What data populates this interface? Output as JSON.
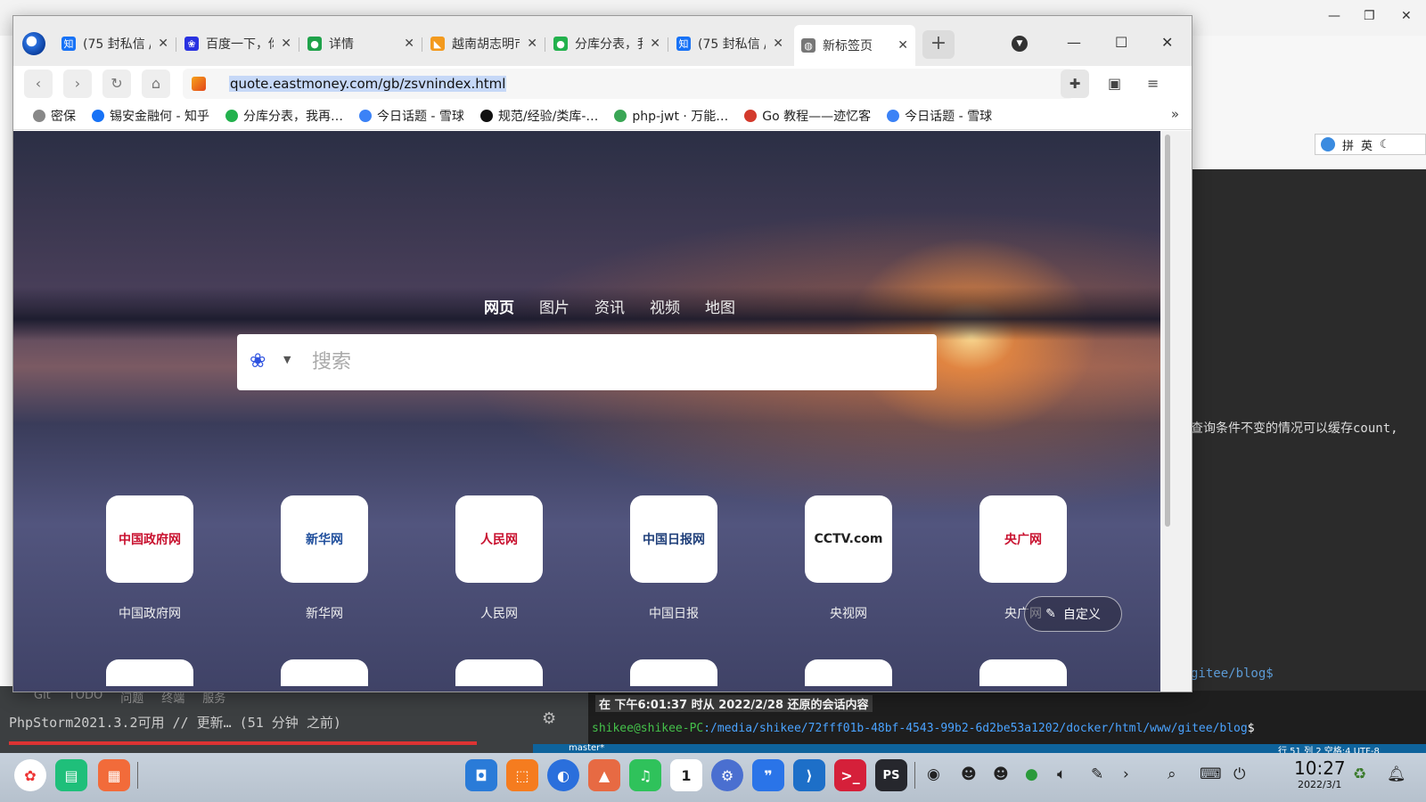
{
  "window": {
    "tabs": [
      {
        "title": "(75 封私信 /",
        "favicon": "zhihu-icon",
        "color": "#1772f6",
        "glyph": "知"
      },
      {
        "title": "百度一下，你",
        "favicon": "baidu-icon",
        "color": "#2932e1",
        "glyph": "❀"
      },
      {
        "title": "详情",
        "favicon": "green-circle-icon",
        "color": "#1fa24a",
        "glyph": "●"
      },
      {
        "title": "越南胡志明市",
        "favicon": "eastmoney-icon",
        "color": "#f39a1e",
        "glyph": "◣"
      },
      {
        "title": "分库分表，我",
        "favicon": "wechat-icon",
        "color": "#23b14d",
        "glyph": "●"
      },
      {
        "title": "(75 封私信 /",
        "favicon": "zhihu-icon",
        "color": "#1772f6",
        "glyph": "知"
      },
      {
        "title": "新标签页",
        "favicon": "globe-icon",
        "color": "#777777",
        "glyph": "◍",
        "active": true
      }
    ],
    "new_tab_label": "+",
    "url": "quote.eastmoney.com/gb/zsvnindex.html"
  },
  "bookmarks": [
    {
      "label": "密保",
      "icon": "globe-icon",
      "color": "#888888"
    },
    {
      "label": "锡安金融何 - 知乎",
      "icon": "zhihu-icon",
      "color": "#1772f6"
    },
    {
      "label": "分库分表，我再…",
      "icon": "wechat-icon",
      "color": "#23b14d"
    },
    {
      "label": "今日话题 - 雪球",
      "icon": "xueqiu-icon",
      "color": "#3b82f6"
    },
    {
      "label": "规范/经验/类库-…",
      "icon": "compass-icon",
      "color": "#111111"
    },
    {
      "label": "php-jwt · 万能…",
      "icon": "cloud-icon",
      "color": "#3aa655"
    },
    {
      "label": "Go 教程——迹忆客",
      "icon": "jiyi-icon",
      "color": "#d33a2c"
    },
    {
      "label": "今日话题 - 雪球",
      "icon": "xueqiu-icon",
      "color": "#3b82f6"
    }
  ],
  "newtab": {
    "search_tabs": [
      "网页",
      "图片",
      "资讯",
      "视频",
      "地图"
    ],
    "search_placeholder": "搜索",
    "tiles": [
      {
        "label": "中国政府网",
        "logo": "中国政府网",
        "logo_color": "#c8102e"
      },
      {
        "label": "新华网",
        "logo": "新华网",
        "logo_color": "#1f4e9c"
      },
      {
        "label": "人民网",
        "logo": "人民网",
        "logo_color": "#c8102e"
      },
      {
        "label": "中国日报",
        "logo": "中国日报网",
        "logo_color": "#1f3f7a"
      },
      {
        "label": "央视网",
        "logo": "CCTV.com",
        "logo_color": "#222222"
      },
      {
        "label": "央广网",
        "logo": "央广网",
        "logo_color": "#c8102e"
      }
    ],
    "customize_label": "自定义"
  },
  "background_ide": {
    "ime_items": [
      "拼",
      "英"
    ],
    "code_line": "查询条件不变的情况可以缓存count,",
    "gitee_prompt": "gitee/blog$",
    "tool_tabs": [
      "Git",
      "TODO",
      "问题",
      "终端",
      "服务"
    ],
    "status_text": "PhpStorm2021.3.2可用 // 更新… (51 分钟 之前)",
    "terminal_restore": "在 下午6:01:37 时从 2022/2/28 还原的会话内容",
    "terminal_user": "shikee@shikee-PC",
    "terminal_path": ":/media/shikee/72fff01b-48bf-4543-99b2-6d2be53a1202/docker/html/www/gitee/blog",
    "terminal_suffix": "$",
    "statusbar_branch": "master*",
    "statusbar_right": "行 51  列 2  空格:4  UTF-8"
  },
  "taskbar": {
    "time": "10:27",
    "date": "2022/3/1",
    "calendar_day": "1",
    "badge_count": "1"
  }
}
